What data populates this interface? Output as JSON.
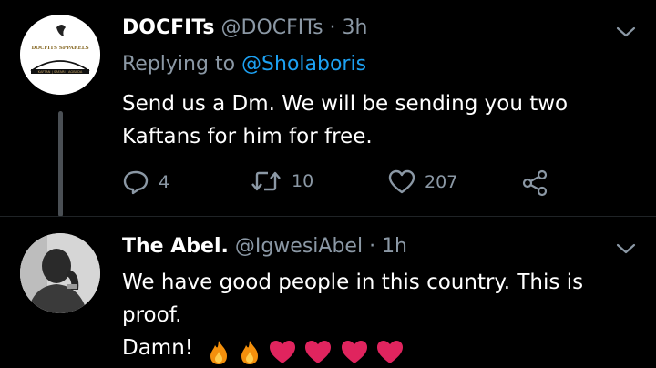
{
  "tweets": [
    {
      "display_name": "DOCFITs",
      "handle": "@DOCFITs",
      "separator": "·",
      "time": "3h",
      "replying_prefix": "Replying to",
      "replying_to": "@Sholaboris",
      "text": "Send us a Dm. We will be sending you two Kaftans for him for free.",
      "avatar_logo_text": "DOCFITS SPPARELS",
      "actions": {
        "replies": "4",
        "retweets": "10",
        "likes": "207"
      }
    },
    {
      "display_name": "The Abel.",
      "handle": "@IgwesiAbel",
      "separator": "·",
      "time": "1h",
      "text_line1": "We have good people in this country. This is proof.",
      "text_line2": "Damn!"
    }
  ],
  "colors": {
    "background": "#000000",
    "text": "#ffffff",
    "secondary": "#8b98a5",
    "mention": "#1da1f2",
    "heart": "#e0245e"
  }
}
